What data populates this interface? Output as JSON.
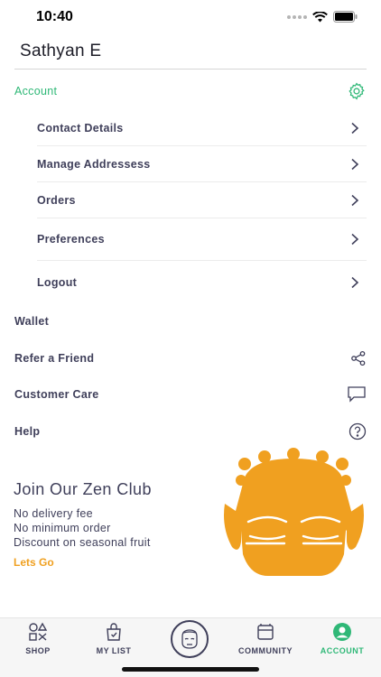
{
  "status": {
    "time": "10:40"
  },
  "user": {
    "name": "Sathyan E"
  },
  "account": {
    "label": "Account",
    "items": [
      {
        "label": "Contact Details"
      },
      {
        "label": "Manage Addressess"
      },
      {
        "label": "Orders"
      },
      {
        "label": "Preferences"
      },
      {
        "label": "Logout"
      }
    ]
  },
  "menu": {
    "wallet": "Wallet",
    "refer": "Refer a Friend",
    "care": "Customer Care",
    "help": "Help"
  },
  "zen": {
    "title": "Join Our Zen Club",
    "lines": [
      "No delivery fee",
      "No minimum order",
      "Discount on seasonal fruit"
    ],
    "cta": "Lets Go"
  },
  "tabs": [
    {
      "label": "SHOP",
      "icon": "shop-icon"
    },
    {
      "label": "MY LIST",
      "icon": "bag-icon"
    },
    {
      "label": "",
      "icon": "zen-face-icon"
    },
    {
      "label": "COMMUNITY",
      "icon": "community-icon"
    },
    {
      "label": "ACCOUNT",
      "icon": "account-icon",
      "active": true
    }
  ],
  "colors": {
    "accent_green": "#2fb877",
    "accent_orange": "#f0a020",
    "text": "#3f3f5a"
  }
}
